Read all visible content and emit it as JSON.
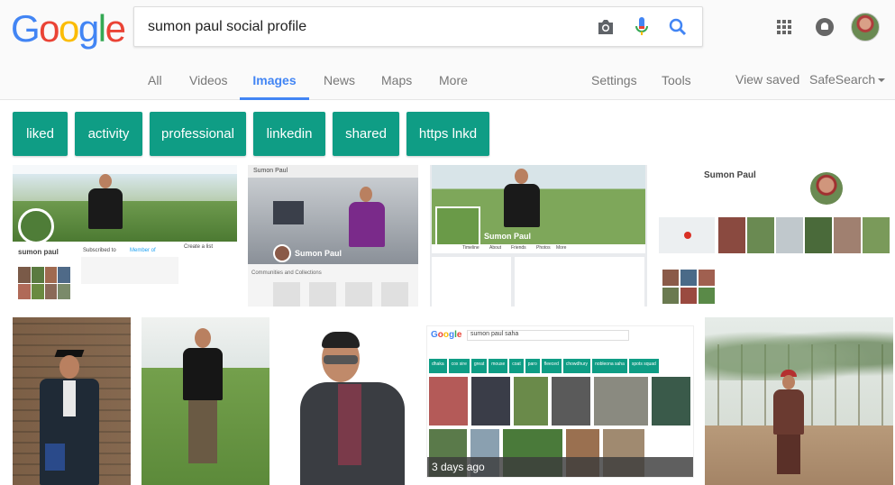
{
  "search": {
    "query": "sumon paul social profile",
    "camera_icon": "camera-icon",
    "mic_icon": "microphone-icon",
    "search_icon": "search-icon"
  },
  "logo": {
    "letters": [
      "G",
      "o",
      "o",
      "g",
      "l",
      "e"
    ],
    "colors": [
      "#4285f4",
      "#ea4335",
      "#fbbc05",
      "#4285f4",
      "#34a853",
      "#ea4335"
    ]
  },
  "nav": {
    "tabs": [
      "All",
      "Videos",
      "Images",
      "News",
      "Maps",
      "More"
    ],
    "active": "Images",
    "settings": "Settings",
    "tools": "Tools",
    "view_saved": "View saved",
    "safesearch": "SafeSearch"
  },
  "chips": [
    "liked",
    "activity",
    "professional",
    "linkedin",
    "shared",
    "https lnkd"
  ],
  "colors": {
    "chip": "#0f9d85",
    "active_tab": "#4285f4",
    "header_bg": "#fafafa"
  },
  "thumbs": {
    "t1": {
      "name": "sumon paul",
      "subscribed": "Subscribed to",
      "member": "Member of",
      "about": "Create a list"
    },
    "t2": {
      "name": "Sumon Paul",
      "section": "Communities and Collections"
    },
    "t3": {
      "name": "Sumon Paul",
      "tabs": [
        "Timeline",
        "About",
        "Friends",
        "Photos",
        "More"
      ]
    },
    "t4": {
      "name": "Sumon Paul"
    },
    "t8": {
      "query": "sumon paul saha",
      "overlay": "3 days ago",
      "chips": [
        "dhaka",
        "cox sire",
        "great",
        "mouse",
        "coat",
        "paro",
        "fleeced",
        "chowdhury",
        "nobleona saha",
        "spots squad"
      ]
    }
  }
}
